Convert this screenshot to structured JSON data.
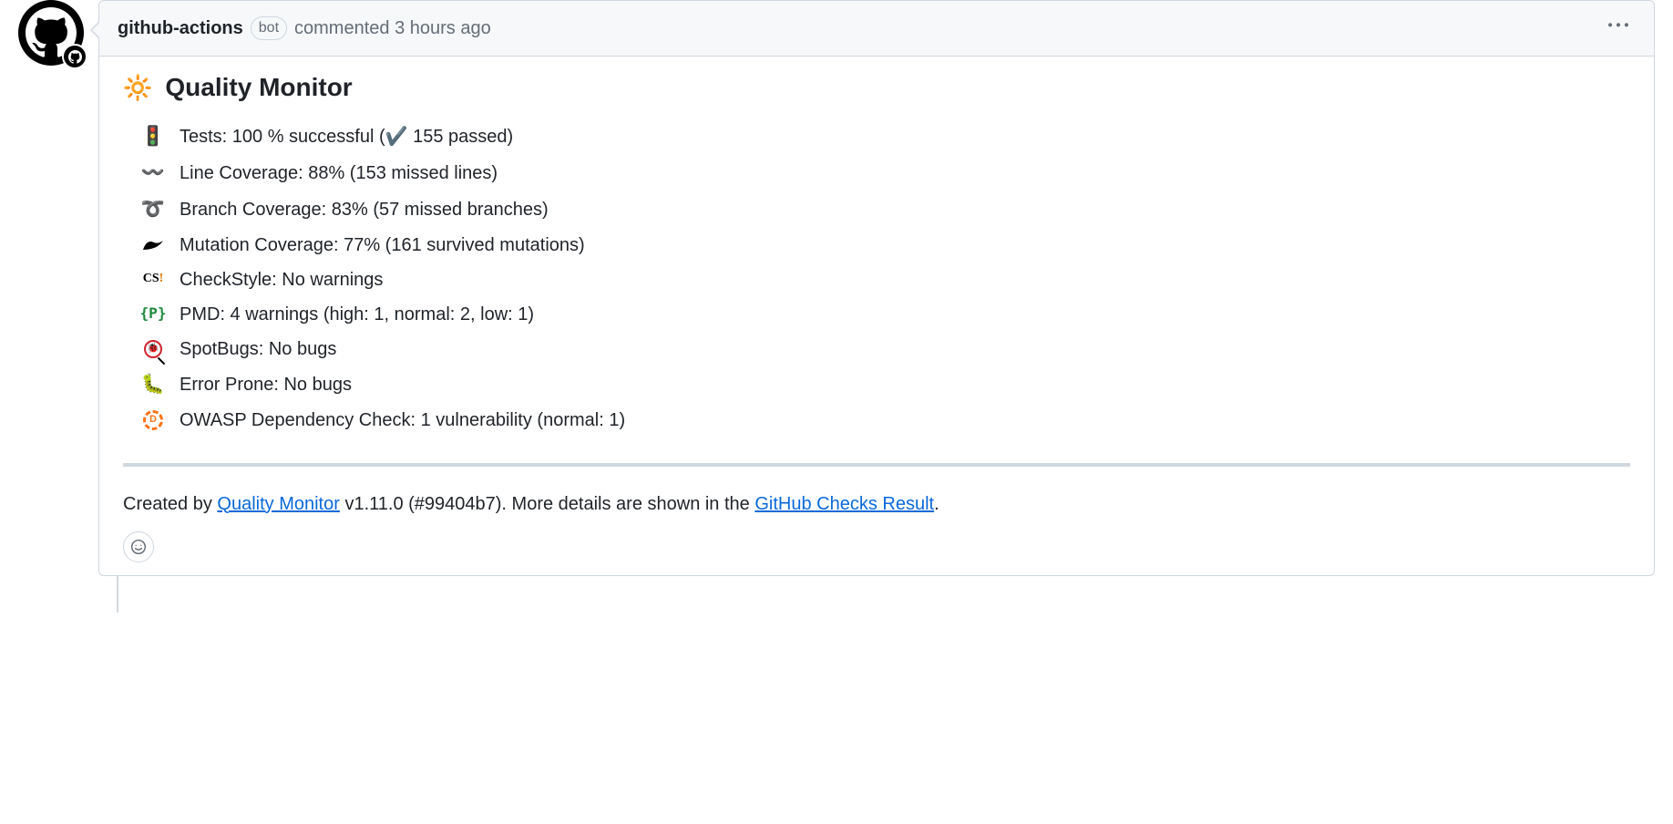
{
  "header": {
    "author": "github-actions",
    "badge": "bot",
    "action": "commented",
    "timestamp": "3 hours ago"
  },
  "body": {
    "title_emoji": "🔆",
    "title": "Quality Monitor",
    "metrics": {
      "tests": "Tests: 100 % successful (✔️ 155 passed)",
      "line_coverage": "Line Coverage: 88% (153 missed lines)",
      "branch_coverage": "Branch Coverage: 83% (57 missed branches)",
      "mutation_coverage": "Mutation Coverage: 77% (161 survived mutations)",
      "checkstyle": "CheckStyle: No warnings",
      "pmd": "PMD: 4 warnings (high: 1, normal: 2, low: 1)",
      "spotbugs": "SpotBugs: No bugs",
      "errorprone": "Error Prone: No bugs",
      "owasp": "OWASP Dependency Check: 1 vulnerability (normal: 1)"
    }
  },
  "footer": {
    "prefix": "Created by ",
    "link1_text": "Quality Monitor",
    "mid": " v1.11.0 (#99404b7). More details are shown in the ",
    "link2_text": "GitHub Checks Result",
    "suffix": "."
  }
}
